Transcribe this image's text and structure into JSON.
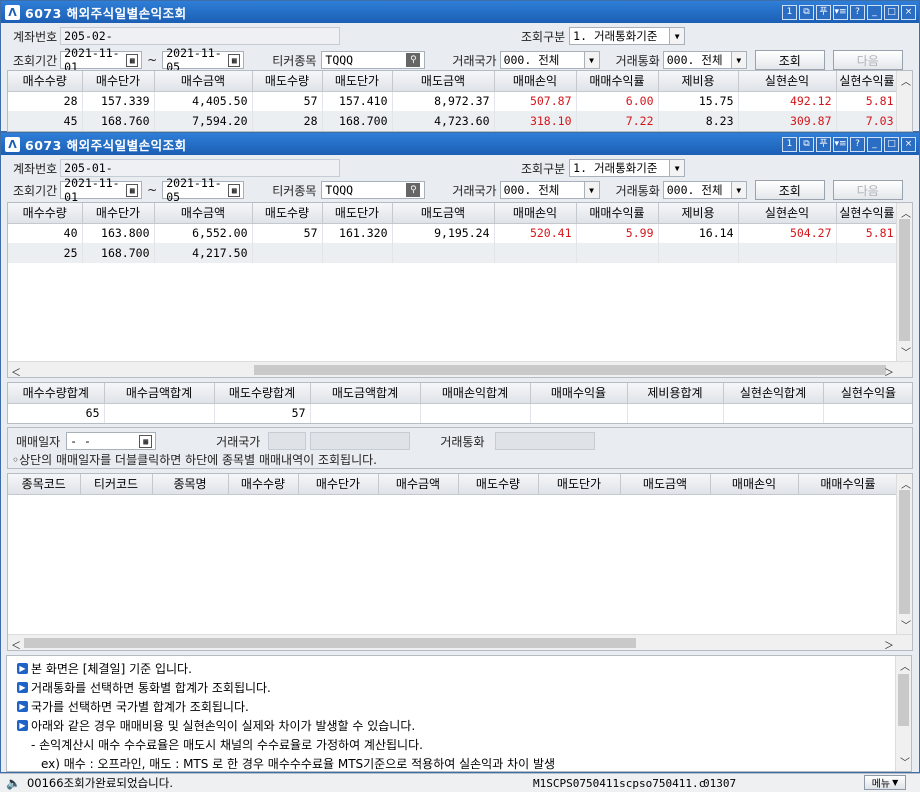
{
  "win1": {
    "title": "6073 해외주식일별손익조회",
    "title_buttons": [
      "1",
      "⧉",
      "푸",
      "▾≡",
      "?",
      "_",
      "□",
      "×"
    ],
    "account_label": "계좌번호",
    "account_value": "205-02-",
    "query_type_label": "조회구분",
    "query_type_value": "1. 거래통화기준",
    "period_label": "조회기간",
    "date_from": "2021-11-01",
    "tilde": "~",
    "date_to": "2021-11-05",
    "ticker_label": "티커종목",
    "ticker_value": "TQQQ",
    "country_label": "거래국가",
    "country_value": "000. 전체",
    "currency_label": "거래통화",
    "currency_value": "000. 전체",
    "query_button": "조회",
    "next_button": "다음",
    "columns": [
      "매수수량",
      "매수단가",
      "매수금액",
      "매도수량",
      "매도단가",
      "매도금액",
      "매매손익",
      "매매수익률",
      "제비용",
      "실현손익",
      "실현수익률"
    ],
    "rows": [
      [
        "28",
        "157.339",
        "4,405.50",
        "57",
        "157.410",
        "8,972.37",
        "507.87",
        "6.00",
        "15.75",
        "492.12",
        "5.81"
      ],
      [
        "45",
        "168.760",
        "7,594.20",
        "28",
        "168.700",
        "4,723.60",
        "318.10",
        "7.22",
        "8.23",
        "309.87",
        "7.03"
      ]
    ]
  },
  "win2": {
    "title": "6073 해외주식일별손익조회",
    "title_buttons": [
      "1",
      "⧉",
      "푸",
      "▾≡",
      "?",
      "_",
      "□",
      "×"
    ],
    "account_label": "계좌번호",
    "account_value": "205-01-",
    "query_type_label": "조회구분",
    "query_type_value": "1. 거래통화기준",
    "period_label": "조회기간",
    "date_from": "2021-11-01",
    "tilde": "~",
    "date_to": "2021-11-05",
    "ticker_label": "티커종목",
    "ticker_value": "TQQQ",
    "country_label": "거래국가",
    "country_value": "000. 전체",
    "currency_label": "거래통화",
    "currency_value": "000. 전체",
    "query_button": "조회",
    "next_button": "다음",
    "columns": [
      "매수수량",
      "매수단가",
      "매수금액",
      "매도수량",
      "매도단가",
      "매도금액",
      "매매손익",
      "매매수익률",
      "제비용",
      "실현손익",
      "실현수익률"
    ],
    "rows": [
      [
        "40",
        "163.800",
        "6,552.00",
        "57",
        "161.320",
        "9,195.24",
        "520.41",
        "5.99",
        "16.14",
        "504.27",
        "5.81"
      ],
      [
        "25",
        "168.700",
        "4,217.50",
        "",
        "",
        "",
        "",
        "",
        "",
        "",
        ""
      ]
    ],
    "summary_columns": [
      "매수수량합계",
      "매수금액합계",
      "매도수량합계",
      "매도금액합계",
      "매매손익합계",
      "매매수익율",
      "제비용합계",
      "실현손익합계",
      "실현수익율"
    ],
    "summary_values": [
      "65",
      "",
      "57",
      "",
      "",
      "",
      "",
      "",
      ""
    ],
    "trade_date_label": "매매일자",
    "trade_date_value": "-  -",
    "trade_country_label": "거래국가",
    "trade_currency_label": "거래통화",
    "hint": "◦상단의 매매일자를 더블클릭하면 하단에 종목별 매매내역이 조회됩니다.",
    "detail_columns": [
      "종목코드",
      "티커코드",
      "종목명",
      "매수수량",
      "매수단가",
      "매수금액",
      "매도수량",
      "매도단가",
      "매도금액",
      "매매손익",
      "매매수익률"
    ],
    "notes": [
      "본 화면은 [체결일] 기준 입니다.",
      "거래통화를 선택하면 통화별 합계가 조회됩니다.",
      "국가를 선택하면 국가별 합계가 조회됩니다.",
      "아래와 같은 경우 매매비용 및 실현손익이 실제와 차이가 발생할 수 있습니다."
    ],
    "sub_notes": [
      "- 손익계산시 매수 수수료율은 매도시 채널의 수수료율로 가정하여 계산됩니다.",
      "ex) 매수 : 오프라인, 매도 : MTS 로 한 경우  매수수수료율 MTS기준으로 적용하여 실손익과 차이 발생"
    ]
  },
  "status": {
    "message": "00166조회가완료되었습니다.",
    "screen_code": "M1SCPS0750411scpso750411.c",
    "code": "01307",
    "menu_button": "메뉴"
  }
}
